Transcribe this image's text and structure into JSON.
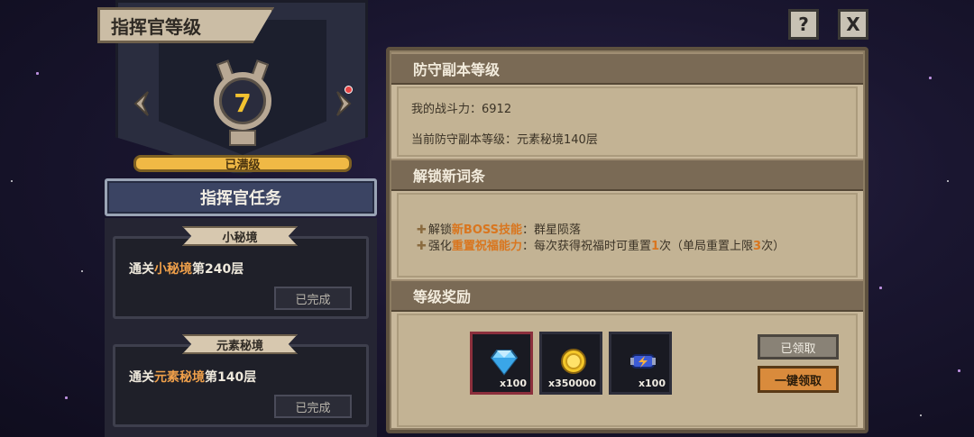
{
  "left": {
    "title": "指挥官等级",
    "level": "7",
    "max_label": "已满级",
    "tasks_header": "指挥官任务",
    "tasks": [
      {
        "category": "小秘境",
        "desc_prefix": "通关",
        "desc_highlight": "小秘境",
        "desc_suffix": "第240层",
        "status": "已完成"
      },
      {
        "category": "元素秘境",
        "desc_prefix": "通关",
        "desc_highlight": "元素秘境",
        "desc_suffix": "第140层",
        "status": "已完成"
      }
    ]
  },
  "top_buttons": {
    "help": "?",
    "close": "X"
  },
  "right": {
    "section1": {
      "header": "防守副本等级",
      "power_label": "我的战斗力：",
      "power_value": "6912",
      "level_label": "当前防守副本等级：",
      "level_value": "元素秘境140层"
    },
    "section2": {
      "header": "解锁新词条",
      "line1_prefix": "解锁",
      "line1_highlight": "新BOSS技能",
      "line1_suffix": "：群星陨落",
      "line2_prefix": "强化",
      "line2_highlight": "重置祝福能力",
      "line2_mid1": "：每次获得祝福时可重置",
      "line2_num1": "1",
      "line2_mid2": "次（单局重置上限",
      "line2_num2": "3",
      "line2_end": "次）"
    },
    "section3": {
      "header": "等级奖励",
      "rewards": [
        {
          "icon": "diamond-icon",
          "qty": "x100"
        },
        {
          "icon": "gold-coin-icon",
          "qty": "x350000"
        },
        {
          "icon": "energy-capsule-icon",
          "qty": "x100"
        }
      ],
      "claimed_label": "已领取",
      "claim_all_label": "一键领取"
    }
  },
  "colors": {
    "highlight": "#d9761f",
    "level_number": "#f2c230",
    "max_bar": "#f0b945"
  }
}
